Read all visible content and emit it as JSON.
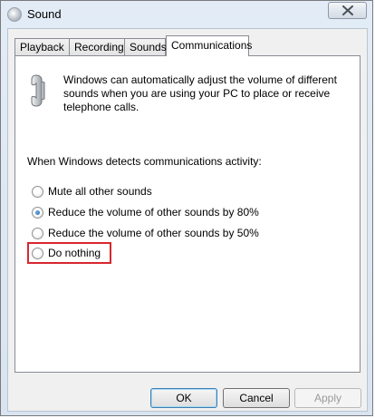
{
  "window": {
    "title": "Sound"
  },
  "tabs": [
    {
      "label": "Playback"
    },
    {
      "label": "Recording"
    },
    {
      "label": "Sounds"
    },
    {
      "label": "Communications",
      "active": true
    }
  ],
  "communications": {
    "description": "Windows can automatically adjust the volume of different sounds when you are using your PC to place or receive telephone calls.",
    "detect_label": "When Windows detects communications activity:",
    "options": [
      {
        "label": "Mute all other sounds",
        "checked": false
      },
      {
        "label": "Reduce the volume of other sounds by 80%",
        "checked": true
      },
      {
        "label": "Reduce the volume of other sounds by 50%",
        "checked": false
      },
      {
        "label": "Do nothing",
        "checked": false
      }
    ]
  },
  "buttons": {
    "ok": "OK",
    "cancel": "Cancel",
    "apply": "Apply"
  },
  "colors": {
    "highlight": "#d9262e",
    "radio_dot": "#1b5ea8"
  }
}
